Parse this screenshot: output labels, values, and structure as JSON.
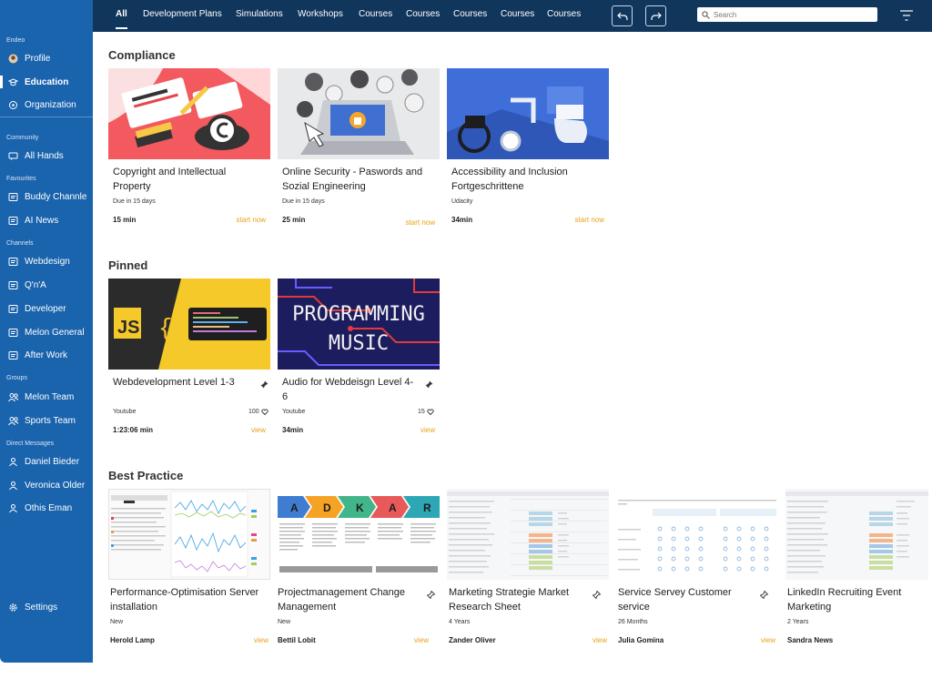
{
  "sidebar": {
    "sections": [
      "Endeo",
      "Community",
      "Favourites",
      "Channels",
      "Groups",
      "Direct Messages"
    ],
    "items": [
      {
        "label": "Profile",
        "icon": "avatar-icon"
      },
      {
        "label": "Education",
        "icon": "education-icon"
      },
      {
        "label": "Organization",
        "icon": "organization-icon"
      },
      {
        "label": "All Hands",
        "icon": "chat-icon"
      },
      {
        "label": "Buddy Channle",
        "icon": "channel-icon"
      },
      {
        "label": "AI News",
        "icon": "channel-icon"
      },
      {
        "label": "Webdesign",
        "icon": "channel-icon"
      },
      {
        "label": "Q'n'A",
        "icon": "channel-icon"
      },
      {
        "label": "Developer",
        "icon": "channel-icon"
      },
      {
        "label": "Melon General",
        "icon": "channel-icon"
      },
      {
        "label": "After Work",
        "icon": "channel-icon"
      },
      {
        "label": "Melon Team",
        "icon": "group-icon"
      },
      {
        "label": "Sports Team",
        "icon": "group-icon"
      },
      {
        "label": "Daniel Bieder",
        "icon": "person-icon"
      },
      {
        "label": "Veronica Older",
        "icon": "person-icon"
      },
      {
        "label": "Othis Eman",
        "icon": "person-icon"
      }
    ],
    "settings_label": "Settings"
  },
  "topbar": {
    "tabs": [
      "All",
      "Development Plans",
      "Simulations",
      "Workshops",
      "Courses",
      "Courses",
      "Courses",
      "Courses",
      "Courses"
    ],
    "search_placeholder": "Search"
  },
  "sections": {
    "compliance": "Compliance",
    "pinned": "Pinned",
    "best_practice": "Best Practice"
  },
  "compliance": [
    {
      "title": "Copyright and Intellectual Property",
      "sub": "Due in 15 days",
      "duration": "15 min",
      "action": "start now"
    },
    {
      "title": "Online Security - Paswords and Sozial Engineering",
      "sub": "Due in 15 days",
      "duration": "25 min",
      "action": "start now"
    },
    {
      "title": "Accessibility and Inclusion Fortgeschrittene",
      "sub": "Udacity",
      "duration": "34min",
      "action": "start now"
    }
  ],
  "pinned": [
    {
      "title": "Webdevelopment Level 1-3",
      "sub": "Youtube",
      "duration": "1:23:06 min",
      "count": "100",
      "action": "view",
      "thumb_text": "JS"
    },
    {
      "title": "Audio for Webdeisgn Level 4-6",
      "sub": "Youtube",
      "duration": "34min",
      "count": "15",
      "action": "view",
      "thumb_text": "PROGRAMMING MUSIC"
    }
  ],
  "best_practice": [
    {
      "title": "Performance-Optimisation Server installation",
      "sub": "New",
      "author": "Herold Lamp",
      "action": "view"
    },
    {
      "title": "Projectmanagement Change Management",
      "sub": "New",
      "author": "Bettil Lobit",
      "action": "view",
      "letters": [
        "A",
        "D",
        "K",
        "A",
        "R"
      ]
    },
    {
      "title": "Marketing Strategie Market Research Sheet",
      "sub": "4 Years",
      "author": "Zander Oliver",
      "action": "view"
    },
    {
      "title": "Service Servey Customer service",
      "sub": "26 Months",
      "author": "Julia Gomina",
      "action": "view"
    },
    {
      "title": "LinkedIn Recruiting Event Marketing",
      "sub": "2 Years",
      "author": "Sandra News",
      "action": "view"
    }
  ],
  "colors": {
    "sidebar": "#1a63ad",
    "topbar": "#10365c",
    "accent": "#e8a317"
  }
}
